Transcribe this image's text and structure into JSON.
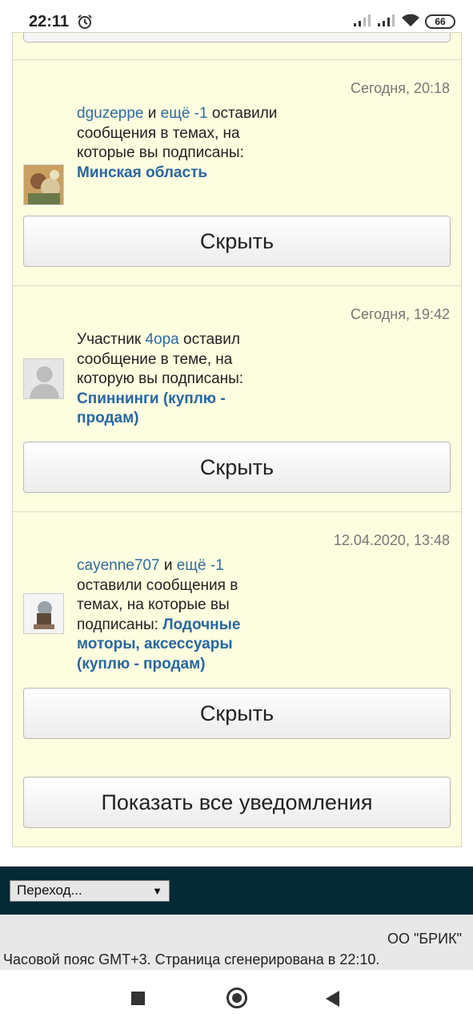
{
  "status_bar": {
    "time": "22:11",
    "battery": "66",
    "icons": [
      "alarm-icon",
      "signal-icon",
      "signal-icon",
      "wifi-icon",
      "battery-icon"
    ]
  },
  "notifications": [
    {
      "date": "Сегодня, 20:18",
      "user": "dguzeppe",
      "and": " и ",
      "more": "ещё -1",
      "text": " оставили сообщения в темах, на которые вы подписаны: ",
      "topic": "Минская область",
      "hide_label": "Скрыть",
      "avatar": "user-avatar-photo"
    },
    {
      "date": "Сегодня, 19:42",
      "prefix": "Участник ",
      "user": "4opa",
      "text": " оставил сообщение в теме, на которую вы подписаны: ",
      "topic": "Спиннинги (куплю - продам)",
      "hide_label": "Скрыть",
      "avatar": "default-avatar-icon"
    },
    {
      "date": "12.04.2020, 13:48",
      "user": "cayenne707",
      "and": " и ",
      "more": "ещё -1",
      "text": " оставили сообщения в темах, на которые вы подписаны: ",
      "topic": "Лодочные моторы, аксессуары (куплю - продам)",
      "hide_label": "Скрыть",
      "avatar": "user-avatar-photo"
    }
  ],
  "show_all_label": "Показать все уведомления",
  "jump_select": {
    "selected": "Переход..."
  },
  "footer": {
    "org": "ОО \"БРИК\"",
    "timezone": "Часовой пояс GMT+3. Страница сгенерирована в 22:10."
  },
  "colors": {
    "panel": "#fdfde0",
    "link": "#2f6ca0",
    "footer_band": "#042a36"
  }
}
